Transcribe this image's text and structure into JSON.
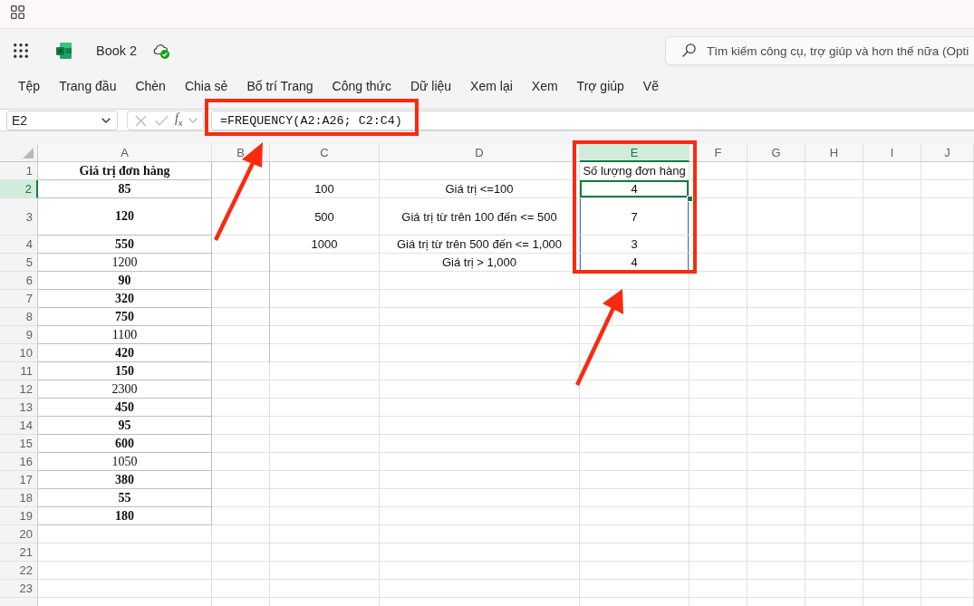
{
  "app_bar": {
    "document_title": "Book 2",
    "search": {
      "placeholder": "Tìm kiếm công cụ, trợ giúp và hơn thế nữa (Opti"
    }
  },
  "ribbon_tabs": [
    "Tệp",
    "Trang đầu",
    "Chèn",
    "Chia sẻ",
    "Bố trí Trang",
    "Công thức",
    "Dữ liệu",
    "Xem lại",
    "Xem",
    "Trợ giúp",
    "Vẽ"
  ],
  "formula_bar": {
    "name_box": "E2",
    "cancel": {
      "disabled": true
    },
    "enter": {
      "disabled": true
    },
    "function_button": "*f*$_{x}$",
    "formula": "=FREQUENCY(A2:A26; C2:C4)"
  },
  "sheet": {
    "columns": [
      {
        "label": "A",
        "selected": false
      },
      {
        "label": "B",
        "selected": false
      },
      {
        "label": "C",
        "selected": false
      },
      {
        "label": "D",
        "selected": false
      },
      {
        "label": "E",
        "selected": true
      },
      {
        "label": "F",
        "selected": false
      },
      {
        "label": "G",
        "selected": false
      },
      {
        "label": "H",
        "selected": false
      },
      {
        "label": "I",
        "selected": false
      },
      {
        "label": "J",
        "selected": false
      }
    ],
    "rows": [
      {
        "label": "1",
        "selected": false
      },
      {
        "label": "2",
        "selected": true
      },
      {
        "label": "3",
        "selected": false
      },
      {
        "label": "4",
        "selected": false
      },
      {
        "label": "5",
        "selected": false
      },
      {
        "label": "6",
        "selected": false
      },
      {
        "label": "7",
        "selected": false
      },
      {
        "label": "8",
        "selected": false
      },
      {
        "label": "9",
        "selected": false
      },
      {
        "label": "10",
        "selected": false
      },
      {
        "label": "11",
        "selected": false
      },
      {
        "label": "12",
        "selected": false
      },
      {
        "label": "13",
        "selected": false
      },
      {
        "label": "14",
        "selected": false
      },
      {
        "label": "15",
        "selected": false
      },
      {
        "label": "16",
        "selected": false
      },
      {
        "label": "17",
        "selected": false
      },
      {
        "label": "18",
        "selected": false
      },
      {
        "label": "19",
        "selected": false
      },
      {
        "label": "20",
        "selected": false
      },
      {
        "label": "21",
        "selected": false
      },
      {
        "label": "22",
        "selected": false
      },
      {
        "label": "23",
        "selected": false
      }
    ],
    "column_a": [
      {
        "text": "Giá trị đơn hàng",
        "bold": true
      },
      {
        "text": "85",
        "bold": true
      },
      {
        "text": "120",
        "bold": true
      },
      {
        "text": "550",
        "bold": true
      },
      {
        "text": "1200",
        "bold": false
      },
      {
        "text": "90",
        "bold": true
      },
      {
        "text": "320",
        "bold": true
      },
      {
        "text": "750",
        "bold": true
      },
      {
        "text": "1100",
        "bold": false
      },
      {
        "text": "420",
        "bold": true
      },
      {
        "text": "150",
        "bold": true
      },
      {
        "text": "2300",
        "bold": false
      },
      {
        "text": "450",
        "bold": true
      },
      {
        "text": "95",
        "bold": true
      },
      {
        "text": "600",
        "bold": true
      },
      {
        "text": "1050",
        "bold": false
      },
      {
        "text": "380",
        "bold": true
      },
      {
        "text": "55",
        "bold": true
      },
      {
        "text": "180",
        "bold": true
      }
    ],
    "column_c": [
      "100",
      "500",
      "1000"
    ],
    "column_d": [
      "Giá trị <=100",
      "Giá trị từ trên 100 đến <= 500",
      "Giá trị từ trên 500 đến <= 1,000",
      "Giá trị > 1,000"
    ],
    "column_e": [
      {
        "text": "Số lượng đơn hàng",
        "selected": false,
        "in_range": false
      },
      {
        "text": "4",
        "selected": true,
        "in_range": true
      },
      {
        "text": "7",
        "selected": false,
        "in_range": true
      },
      {
        "text": "3",
        "selected": false,
        "in_range": true
      },
      {
        "text": "4",
        "selected": false,
        "in_range": true
      }
    ]
  }
}
